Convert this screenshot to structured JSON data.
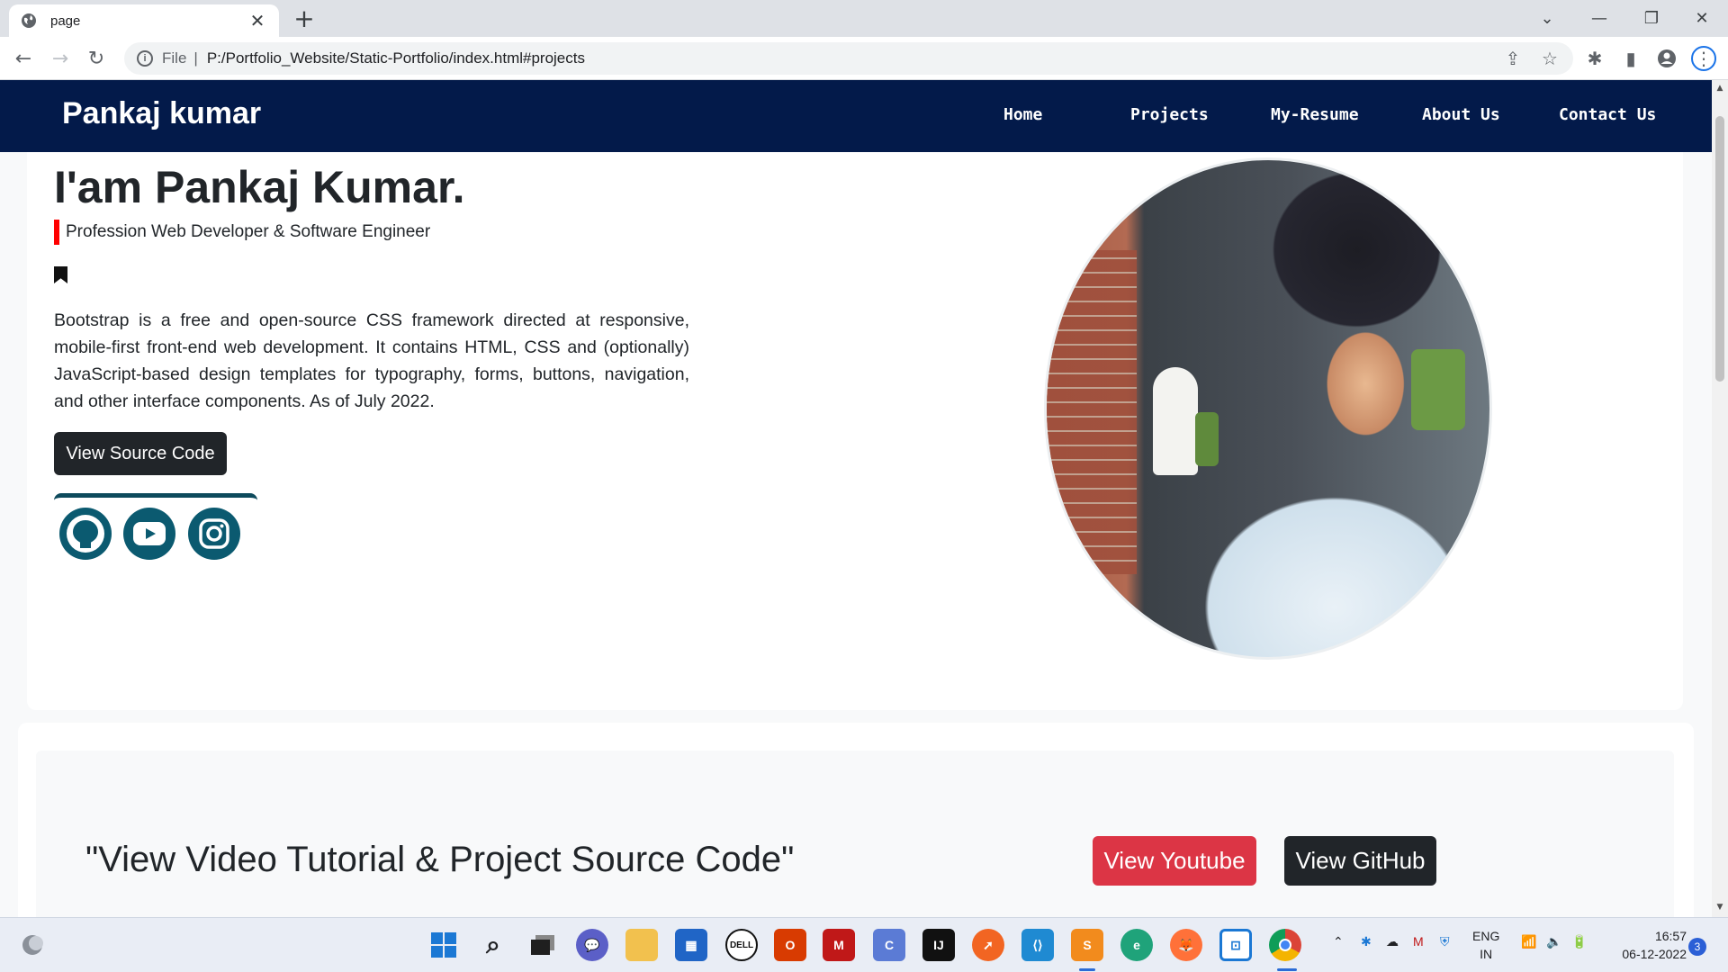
{
  "browser": {
    "tab_title": "page",
    "address_scheme": "File",
    "address_url": "P:/Portfolio_Website/Static-Portfolio/index.html#projects"
  },
  "site": {
    "brand": "Pankaj kumar",
    "nav": [
      "Home",
      "Projects",
      "My-Resume",
      "About Us",
      "Contact Us"
    ]
  },
  "hero": {
    "title": "I'am Pankaj Kumar.",
    "subtitle": "Profession Web Developer & Software Engineer",
    "description": "Bootstrap is a free and open-source CSS framework directed at responsive, mobile-first front-end web development. It contains HTML, CSS and (optionally) JavaScript-based design templates for typography, forms, buttons, navigation, and other interface components. As of July 2022.",
    "source_button": "View Source Code",
    "social": [
      "github-icon",
      "youtube-icon",
      "instagram-icon"
    ]
  },
  "tutorial_section": {
    "title": "\"View Video Tutorial & Project Source Code\"",
    "youtube_button": "View Youtube",
    "github_button": "View GitHub"
  },
  "taskbar": {
    "language": "ENG",
    "region": "IN",
    "time": "16:57",
    "date": "06-12-2022",
    "notifications": "3"
  },
  "colors": {
    "navbar": "#031a4a",
    "accent_red": "#dc3545",
    "dark_button": "#212529",
    "social_teal": "#0b5a70"
  }
}
